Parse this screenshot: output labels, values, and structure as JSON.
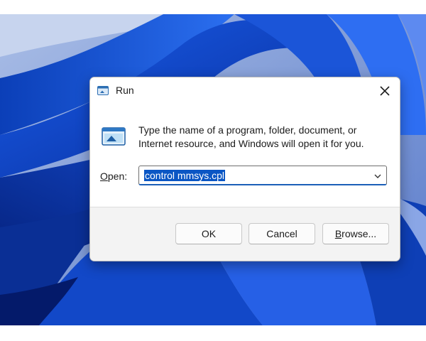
{
  "dialog": {
    "title": "Run",
    "close_icon": "close-icon",
    "title_icon": "run-app-icon",
    "description_line1": "Type the name of a program, folder, document, or",
    "description_line2": "Internet resource, and Windows will open it for you.",
    "open_label_accel": "O",
    "open_label_rest": "pen:",
    "open_value": "control mmsys.cpl",
    "dropdown_icon": "chevron-down-icon",
    "buttons": {
      "ok": "OK",
      "cancel": "Cancel",
      "browse_accel": "B",
      "browse_rest": "rowse..."
    }
  },
  "colors": {
    "wallpaper_primary": "#0b3fb8",
    "selection": "#0a56c4",
    "dialog_bg": "#f3f3f3"
  }
}
